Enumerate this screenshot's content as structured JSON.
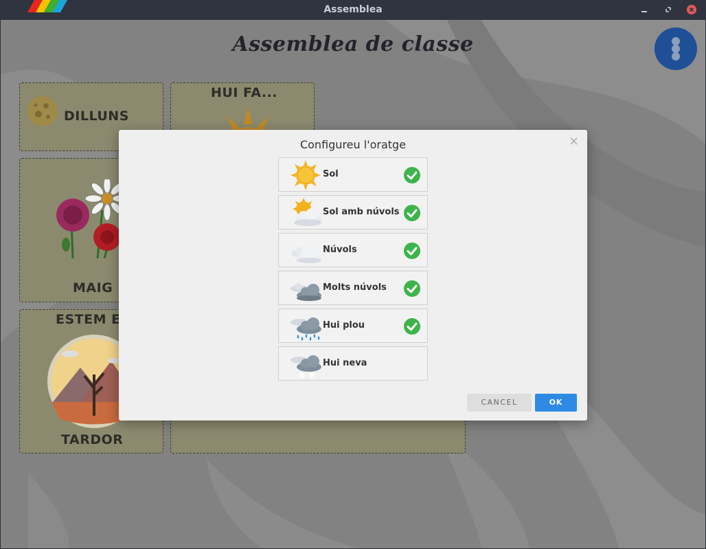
{
  "window": {
    "title": "Assemblea",
    "logo_icon": "rainbow-stripes-logo",
    "controls": [
      "minimize-icon",
      "maximize-icon",
      "close-icon"
    ]
  },
  "app": {
    "title": "Assemblea de classe",
    "menu_icon": "more-vertical-icon"
  },
  "cards": {
    "day": {
      "label": "DILLUNS",
      "icon": "moon-icon"
    },
    "weather": {
      "label": "HUI FA...",
      "icon": "sun-icon"
    },
    "month": {
      "label": "MAIG",
      "icon": "carnation-flowers-icon"
    },
    "season": {
      "heading": "ESTEM E",
      "label": "TARDOR",
      "icon": "autumn-landscape-icon"
    }
  },
  "dialog": {
    "title": "Configureu l'oratge",
    "close_glyph": "×",
    "options": [
      {
        "label": "Sol",
        "icon": "sun-icon",
        "checked": true
      },
      {
        "label": "Sol amb núvols",
        "icon": "sun-cloud-icon",
        "checked": true
      },
      {
        "label": "Núvols",
        "icon": "clouds-icon",
        "checked": true
      },
      {
        "label": "Molts núvols",
        "icon": "dark-clouds-icon",
        "checked": true
      },
      {
        "label": "Hui plou",
        "icon": "rain-icon",
        "checked": true
      },
      {
        "label": "Hui neva",
        "icon": "snow-icon",
        "checked": false
      }
    ],
    "cancel_label": "CANCEL",
    "ok_label": "OK"
  },
  "colors": {
    "accent": "#2d8be6",
    "check_green": "#3cb44b",
    "fab": "#1f4f96",
    "card": "#8b8a6f"
  }
}
